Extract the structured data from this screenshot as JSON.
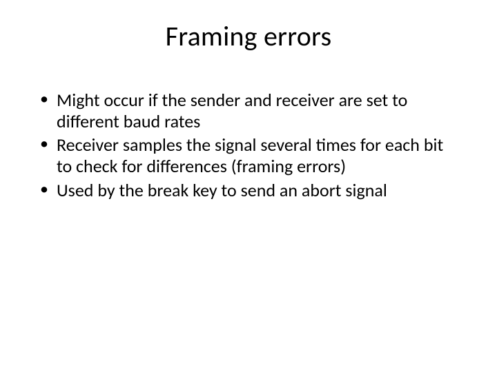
{
  "slide": {
    "title": "Framing errors",
    "bullets": [
      "Might occur if the sender and receiver are set to different baud rates",
      "Receiver samples the signal several times for each bit to check for differences (framing errors)",
      "Used by the break key to send an abort signal"
    ]
  }
}
